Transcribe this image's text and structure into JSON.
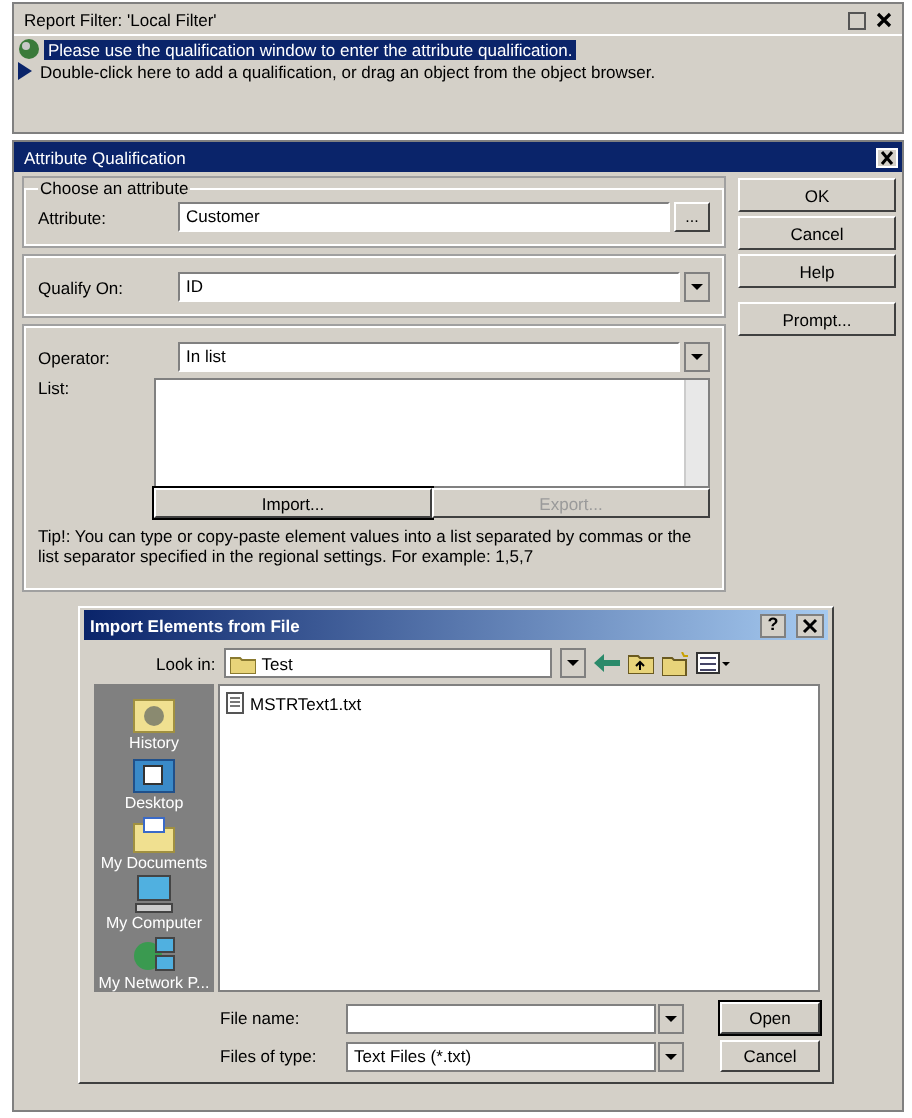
{
  "report_filter": {
    "title": "Report Filter: 'Local Filter'",
    "lines": [
      {
        "kind": "info",
        "text": "Please use the qualification window to enter the attribute qualification.",
        "selected": true
      },
      {
        "kind": "hint",
        "text": "Double-click here to add a qualification, or drag an object from the object browser.",
        "selected": false
      }
    ]
  },
  "qualification": {
    "title": "Attribute Qualification",
    "legend": "Choose an attribute",
    "attribute_label": "Attribute:",
    "attribute_value": "Customer",
    "browse": "...",
    "qualify_label": "Qualify On:",
    "qualify_value": "ID",
    "operator_label": "Operator:",
    "operator_value": "In list",
    "list_label": "List:",
    "list_buttons": [
      {
        "label": "Import...",
        "disabled": false
      },
      {
        "label": "Export...",
        "disabled": true
      }
    ],
    "tip": "Tip!:  You can type or copy-paste element values into a list separated by commas or the list separator specified in the regional settings. For example: 1,5,7",
    "buttons": [
      "OK",
      "Cancel",
      "Help",
      "Prompt..."
    ]
  },
  "import_dialog": {
    "title": "Import Elements from File",
    "help": "?",
    "look_in_label": "Look in:",
    "look_in_value": "Test",
    "places": [
      {
        "kind": "history",
        "label": "History"
      },
      {
        "kind": "desktop",
        "label": "Desktop"
      },
      {
        "kind": "documents",
        "label": "My Documents"
      },
      {
        "kind": "computer",
        "label": "My Computer"
      },
      {
        "kind": "network",
        "label": "My Network P..."
      }
    ],
    "files": [
      "MSTRText1.txt"
    ],
    "file_name_label": "File name:",
    "file_type_label": "Files of type:",
    "file_type_value": "Text Files (*.txt)",
    "buttons": [
      "Open",
      "Cancel"
    ]
  }
}
